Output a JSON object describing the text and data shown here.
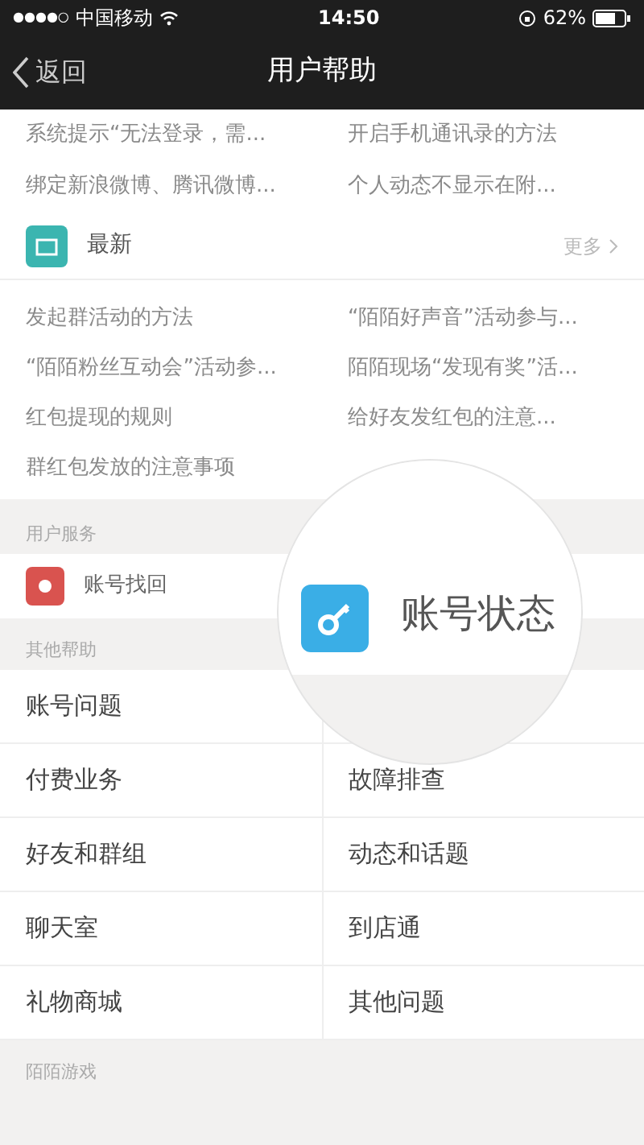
{
  "status_bar": {
    "signal_dots": "●●●●○",
    "carrier": "中国移动",
    "time": "14:50",
    "battery": "62%"
  },
  "nav": {
    "back": "返回",
    "title": "用户帮助"
  },
  "top_items": [
    [
      "系统提示“无法登录，需...",
      "开启手机通讯录的方法"
    ],
    [
      "绑定新浪微博、腾讯微博...",
      "个人动态不显示在附..."
    ]
  ],
  "latest": {
    "title": "最新",
    "more": "更多",
    "items": [
      [
        "发起群活动的方法",
        "“陌陌好声音”活动参与..."
      ],
      [
        "“陌陌粉丝互动会”活动参...",
        "陌陌现场“发现有奖”活..."
      ],
      [
        "红包提现的规则",
        "给好友发红包的注意..."
      ],
      [
        "群红包发放的注意事项"
      ]
    ]
  },
  "user_service": {
    "title": "用户服务",
    "items": [
      {
        "label": "账号找回",
        "color": "#d9534f"
      }
    ]
  },
  "magnifier": {
    "label": "账号状态",
    "color": "#3aaee6"
  },
  "other_help": {
    "title": "其他帮助",
    "items": [
      [
        "账号问题"
      ],
      [
        "付费业务",
        "故障排查"
      ],
      [
        "好友和群组",
        "动态和话题"
      ],
      [
        "聊天室",
        "到店通"
      ],
      [
        "礼物商城",
        "其他问题"
      ]
    ]
  },
  "footer_section": {
    "title": "陌陌游戏"
  }
}
